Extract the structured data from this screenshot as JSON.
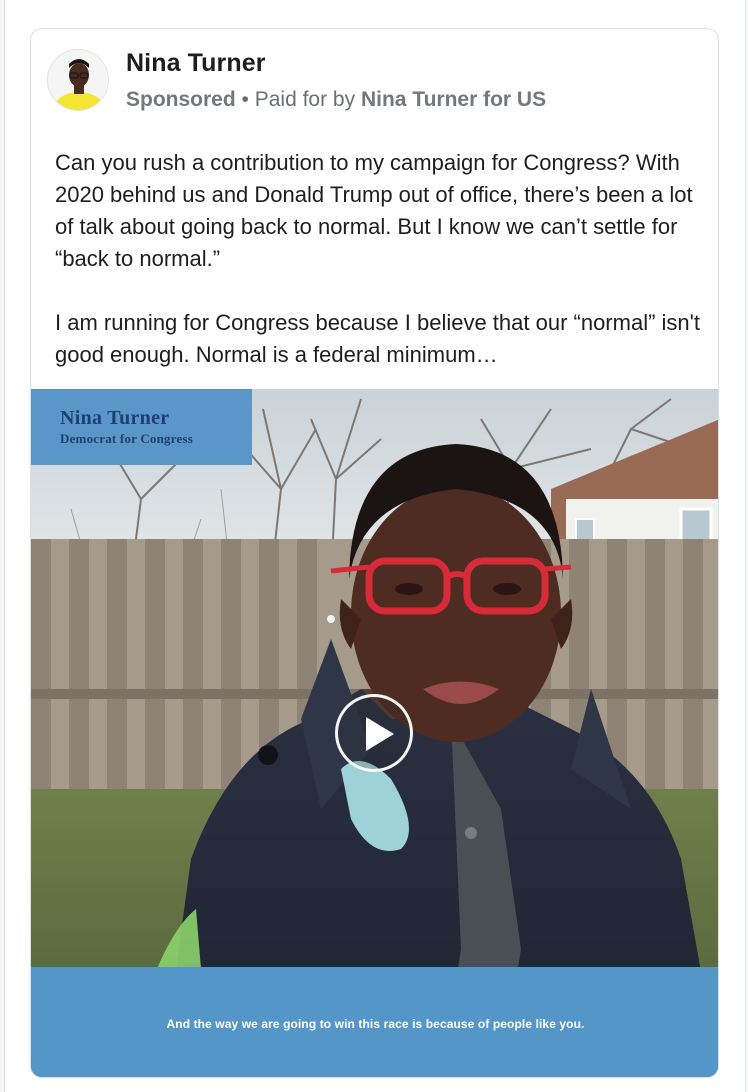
{
  "post": {
    "author": "Nina Turner",
    "sponsored_label": "Sponsored",
    "separator": " • ",
    "paid_for_prefix": "Paid for by ",
    "paid_for_entity": "Nina Turner for US",
    "paragraph_1": "Can you rush a contribution to my campaign for Congress? With 2020 behind us and Donald Trump out of office, there’s been a lot of talk about going back to normal. But I know we can’t settle for “back to normal.”",
    "paragraph_2": "I am running for Congress because I believe that our “normal” isn't good enough. Normal is a federal minimum…"
  },
  "video": {
    "badge_name": "Nina Turner",
    "badge_subtitle": "Democrat for Congress",
    "caption": "And the way we are going to win this race is because of people like you.",
    "play_icon": "play-icon"
  },
  "colors": {
    "badge_bg": "#5b96c8",
    "badge_text": "#1f3f73",
    "caption_bg": "#5596c9"
  }
}
